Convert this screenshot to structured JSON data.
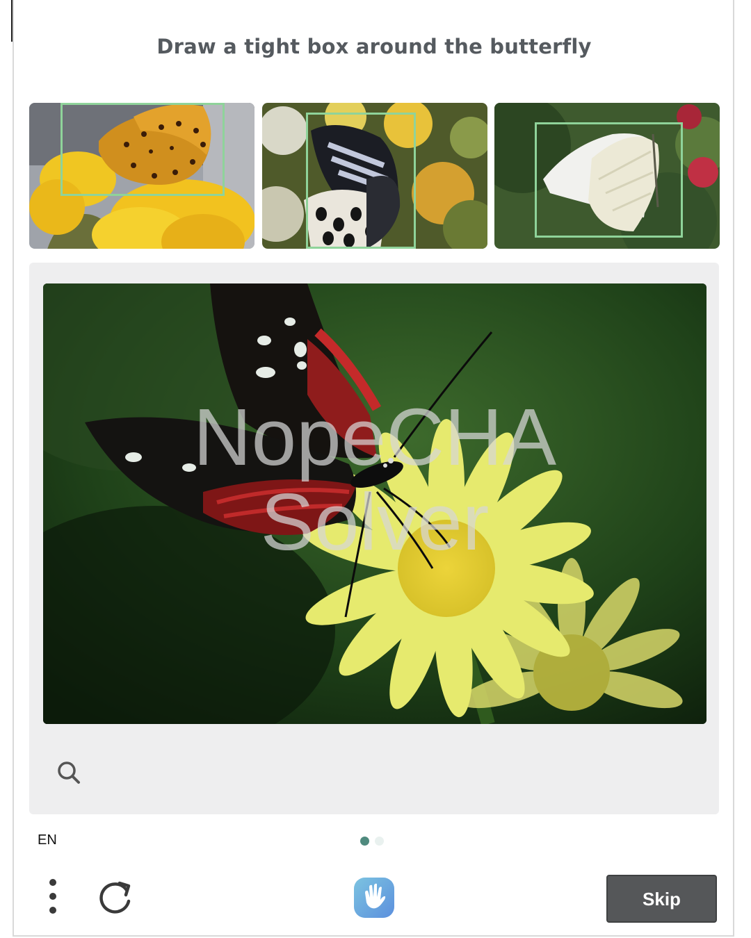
{
  "prompt": "Draw a tight box around the butterfly",
  "examples": [
    {
      "icon": "orange-butterfly-on-yellow-flower"
    },
    {
      "icon": "black-swallowtail-butterfly-on-flowers"
    },
    {
      "icon": "white-butterfly-on-leaves"
    }
  ],
  "task_image": {
    "icon": "red-black-butterfly-on-yellow-daisy",
    "watermark": [
      "NopeCHA",
      "Solver"
    ]
  },
  "language": "EN",
  "pagination": {
    "dots": 2,
    "active": 1,
    "active_color": "#4f8a7e",
    "inactive_color": "#e9f1ef"
  },
  "footer": {
    "menu_icon": "vertical-dots-icon",
    "refresh_icon": "refresh-icon",
    "logo_icon": "hand-logo-icon",
    "skip_label": "Skip",
    "skip_color": "#555759"
  },
  "colors": {
    "example_box": "#8fd39a",
    "prompt_text": "#555a5f"
  }
}
